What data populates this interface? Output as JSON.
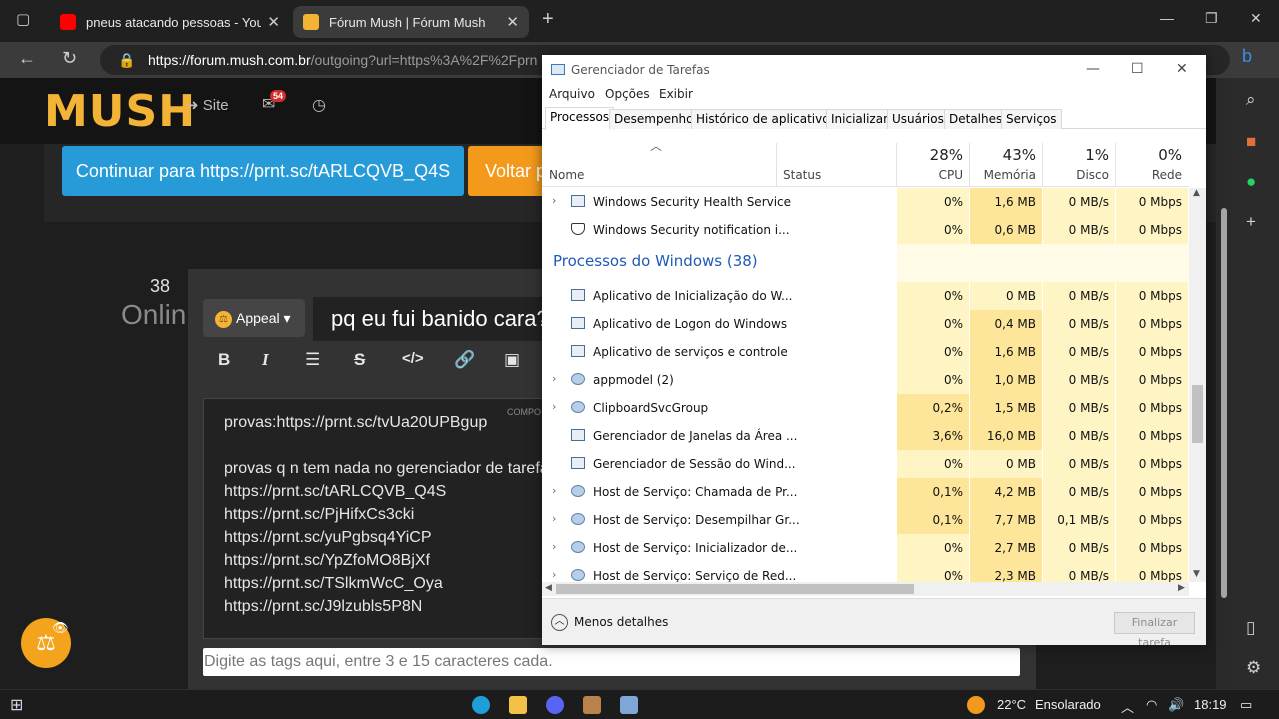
{
  "browser": {
    "tabs": [
      {
        "title": "pneus atacando pessoas - YouTu",
        "active": false,
        "favicon_color": "#ff0000"
      },
      {
        "title": "Fórum Mush | Fórum Mush",
        "active": true,
        "favicon_color": "#f3b436"
      }
    ],
    "url_host": "https://forum.mush.com.br",
    "url_path": "/outgoing?url=https%3A%2F%2Fprn"
  },
  "site": {
    "logo": "MUSH",
    "site_link": "Site",
    "notif_count": "54",
    "continue_button": "Continuar para https://prnt.sc/tARLCQVB_Q4S",
    "back_button": "Voltar p",
    "online_count": "38",
    "online_label": "Onlin"
  },
  "composer": {
    "category": "Appeal",
    "title": "pq eu fui banido cara?",
    "compose_label": "COMPO",
    "lines": [
      "provas:https://prnt.sc/tvUa20UPBgup",
      "",
      "provas q n tem nada no gerenciador de tarefa",
      "https://prnt.sc/tARLCQVB_Q4S",
      "https://prnt.sc/PjHifxCs3cki",
      "https://prnt.sc/yuPgbsq4YiCP",
      "https://prnt.sc/YpZfoMO8BjXf",
      "https://prnt.sc/TSlkmWcC_Oya",
      "https://prnt.sc/J9lzubls5P8N"
    ],
    "tags_placeholder": "Digite as tags aqui, entre 3 e 15 caracteres cada."
  },
  "taskmgr": {
    "title": "Gerenciador de Tarefas",
    "menu": [
      "Arquivo",
      "Opções",
      "Exibir"
    ],
    "tabs": [
      "Processos",
      "Desempenho",
      "Histórico de aplicativos",
      "Inicializar",
      "Usuários",
      "Detalhes",
      "Serviços"
    ],
    "columns": {
      "name": "Nome",
      "status": "Status",
      "cpu_pct": "28%",
      "cpu": "CPU",
      "mem_pct": "43%",
      "mem": "Memória",
      "disk_pct": "1%",
      "disk": "Disco",
      "net_pct": "0%",
      "net": "Rede"
    },
    "group_windows": "Processos do Windows (38)",
    "rows_top": [
      {
        "name": "Windows Security Health Service",
        "cpu": "0%",
        "mem": "1,6 MB",
        "disk": "0 MB/s",
        "net": "0 Mbps",
        "expand": true,
        "icon": "window"
      },
      {
        "name": "Windows Security notification i...",
        "cpu": "0%",
        "mem": "0,6 MB",
        "disk": "0 MB/s",
        "net": "0 Mbps",
        "expand": false,
        "icon": "shield"
      }
    ],
    "rows_win": [
      {
        "name": "Aplicativo de Inicialização do W...",
        "cpu": "0%",
        "mem": "0 MB",
        "disk": "0 MB/s",
        "net": "0 Mbps",
        "expand": false,
        "icon": "window"
      },
      {
        "name": "Aplicativo de Logon do Windows",
        "cpu": "0%",
        "mem": "0,4 MB",
        "disk": "0 MB/s",
        "net": "0 Mbps",
        "expand": false,
        "icon": "window"
      },
      {
        "name": "Aplicativo de serviços e controle",
        "cpu": "0%",
        "mem": "1,6 MB",
        "disk": "0 MB/s",
        "net": "0 Mbps",
        "expand": false,
        "icon": "window"
      },
      {
        "name": "appmodel (2)",
        "cpu": "0%",
        "mem": "1,0 MB",
        "disk": "0 MB/s",
        "net": "0 Mbps",
        "expand": true,
        "icon": "gear"
      },
      {
        "name": "ClipboardSvcGroup",
        "cpu": "0,2%",
        "mem": "1,5 MB",
        "disk": "0 MB/s",
        "net": "0 Mbps",
        "expand": true,
        "icon": "gear"
      },
      {
        "name": "Gerenciador de Janelas da Área ...",
        "cpu": "3,6%",
        "mem": "16,0 MB",
        "disk": "0 MB/s",
        "net": "0 Mbps",
        "expand": false,
        "icon": "window"
      },
      {
        "name": "Gerenciador de Sessão do Wind...",
        "cpu": "0%",
        "mem": "0 MB",
        "disk": "0 MB/s",
        "net": "0 Mbps",
        "expand": false,
        "icon": "window"
      },
      {
        "name": "Host de Serviço: Chamada de Pr...",
        "cpu": "0,1%",
        "mem": "4,2 MB",
        "disk": "0 MB/s",
        "net": "0 Mbps",
        "expand": true,
        "icon": "gear"
      },
      {
        "name": "Host de Serviço: Desempilhar Gr...",
        "cpu": "0,1%",
        "mem": "7,7 MB",
        "disk": "0,1 MB/s",
        "net": "0 Mbps",
        "expand": true,
        "icon": "gear"
      },
      {
        "name": "Host de Serviço: Inicializador de...",
        "cpu": "0%",
        "mem": "2,7 MB",
        "disk": "0 MB/s",
        "net": "0 Mbps",
        "expand": true,
        "icon": "gear"
      },
      {
        "name": "Host de Serviço: Serviço de Red...",
        "cpu": "0%",
        "mem": "2,3 MB",
        "disk": "0 MB/s",
        "net": "0 Mbps",
        "expand": true,
        "icon": "gear"
      }
    ],
    "less_details": "Menos detalhes",
    "end_task": "Finalizar tarefa"
  },
  "taskbar": {
    "temperature": "22°C",
    "weather": "Ensolarado",
    "time": "18:19"
  }
}
